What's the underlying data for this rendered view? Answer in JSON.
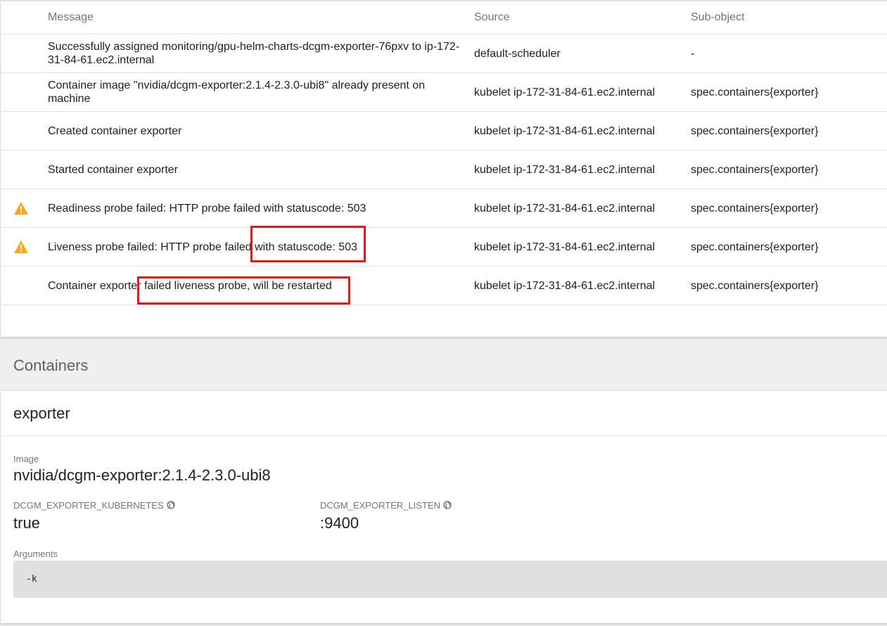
{
  "events": {
    "columns": {
      "message": "Message",
      "source": "Source",
      "sub_object": "Sub-object"
    },
    "rows": [
      {
        "warning": false,
        "message": "Successfully assigned monitoring/gpu-helm-charts-dcgm-exporter-76pxv to ip-172-31-84-61.ec2.internal",
        "source": "default-scheduler",
        "sub_object": "-"
      },
      {
        "warning": false,
        "message": "Container image \"nvidia/dcgm-exporter:2.1.4-2.3.0-ubi8\" already present on machine",
        "source": "kubelet ip-172-31-84-61.ec2.internal",
        "sub_object": "spec.containers{exporter}"
      },
      {
        "warning": false,
        "message": "Created container exporter",
        "source": "kubelet ip-172-31-84-61.ec2.internal",
        "sub_object": "spec.containers{exporter}"
      },
      {
        "warning": false,
        "message": "Started container exporter",
        "source": "kubelet ip-172-31-84-61.ec2.internal",
        "sub_object": "spec.containers{exporter}"
      },
      {
        "warning": true,
        "message": "Readiness probe failed: HTTP probe failed with statuscode: 503",
        "source": "kubelet ip-172-31-84-61.ec2.internal",
        "sub_object": "spec.containers{exporter}"
      },
      {
        "warning": true,
        "message": "Liveness probe failed: HTTP probe failed with statuscode: 503",
        "source": "kubelet ip-172-31-84-61.ec2.internal",
        "sub_object": "spec.containers{exporter}"
      },
      {
        "warning": false,
        "message": "Container exporter failed liveness probe, will be restarted",
        "source": "kubelet ip-172-31-84-61.ec2.internal",
        "sub_object": "spec.containers{exporter}"
      }
    ]
  },
  "containers": {
    "section_title": "Containers",
    "name": "exporter",
    "image_label": "Image",
    "image_value": "nvidia/dcgm-exporter:2.1.4-2.3.0-ubi8",
    "env": [
      {
        "name": "DCGM_EXPORTER_KUBERNETES",
        "value": "true"
      },
      {
        "name": "DCGM_EXPORTER_LISTEN",
        "value": ":9400"
      }
    ],
    "arguments_label": "Arguments",
    "arguments_value": "-k"
  },
  "colors": {
    "warning": "#f9a825",
    "highlight": "#e8171c"
  },
  "icons": {
    "warning": "warning-icon",
    "env_source": "globe-icon"
  }
}
